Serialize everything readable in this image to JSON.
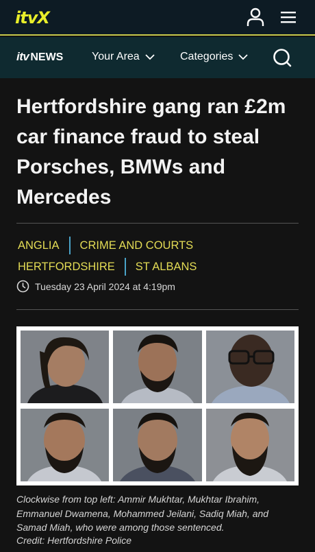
{
  "topbar": {
    "logo": "itvX",
    "account_icon": "user-icon",
    "menu_icon": "hamburger-menu-icon"
  },
  "newsbar": {
    "logo_itv": "itv",
    "logo_news": "NEWS",
    "your_area": "Your Area",
    "categories": "Categories",
    "search_icon": "search-icon"
  },
  "article": {
    "headline": "Hertfordshire gang ran £2m car finance fraud to steal Porsches, BMWs and Mercedes",
    "tags": [
      "ANGLIA",
      "CRIME AND COURTS",
      "HERTFORDSHIRE",
      "ST ALBANS"
    ],
    "date": "Tuesday 23 April 2024 at 4:19pm",
    "caption": "Clockwise from top left: Ammir Mukhtar, Mukhtar Ibrahim, Emmanuel Dwamena, Mohammed Jeilani, Sadiq Miah, and Samad Miah, who were among those sentenced.",
    "credit": "Credit: Hertfordshire Police"
  },
  "colors": {
    "brand_yellow": "#e8ee2a",
    "tag_yellow": "#e4dc55",
    "tag_separator": "#4aa3c8",
    "news_bar": "#0f2a30",
    "background": "#131313"
  }
}
